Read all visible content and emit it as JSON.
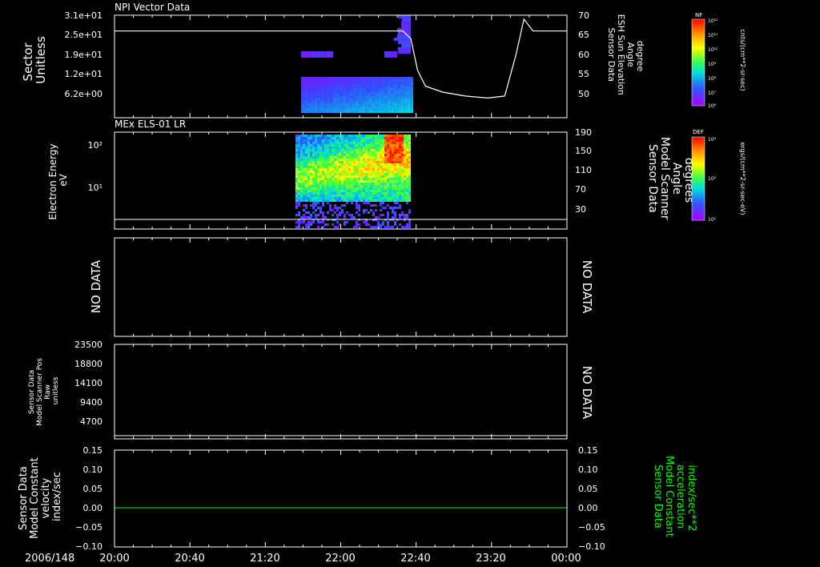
{
  "date_label": "2006/148",
  "x_ticks": [
    "20:00",
    "20:40",
    "21:20",
    "22:00",
    "22:40",
    "23:20",
    "00:00"
  ],
  "colors": {
    "frame": "#ffffff",
    "accent_green": "#00ff00",
    "background": "#000000"
  },
  "chart_data": [
    {
      "type": "heatmap",
      "title": "NPI Vector Data",
      "ylabel_lines": [
        "Sector",
        "Unitless"
      ],
      "y_ticks": [
        "3.1e+01",
        "2.5e+01",
        "1.9e+01",
        "1.2e+01",
        "6.2e+00"
      ],
      "y2_label_lines": [
        "Sensor Data",
        "ESH Sun Elevation",
        "Angle",
        "degree"
      ],
      "y2_ticks": [
        "70",
        "65",
        "60",
        "55",
        "50"
      ],
      "y2_range": [
        44,
        70
      ],
      "x_range_hours": [
        20,
        24
      ],
      "data_interval_hours": [
        21.65,
        22.62
      ],
      "colorbar": {
        "label": "NF",
        "units": "cnts/(cm**2-sr-sec)",
        "ticks": [
          "10¹²",
          "10¹¹",
          "10¹⁰",
          "10⁹",
          "10⁸",
          "10⁷",
          "10⁶"
        ]
      },
      "line_series": {
        "name": "ESH Sun Elevation Angle",
        "x_hours": [
          20.0,
          22.3,
          22.55,
          22.62,
          22.68,
          22.75,
          22.9,
          23.1,
          23.3,
          23.45,
          23.55,
          23.62,
          23.7,
          24.0
        ],
        "y_deg": [
          66,
          66,
          66,
          64,
          56,
          52,
          50.5,
          49.5,
          49,
          49.5,
          60,
          69,
          66,
          66
        ]
      }
    },
    {
      "type": "heatmap",
      "title": "MEx ELS-01 LR",
      "ylabel_lines": [
        "Electron Energy",
        "eV"
      ],
      "y_ticks": [
        "10²",
        "10¹"
      ],
      "y2_label_lines": [
        "Sensor Data",
        "Model Scanner",
        "Angle",
        "degrees"
      ],
      "y2_ticks": [
        "190",
        "150",
        "110",
        "70",
        "30"
      ],
      "y2_range": [
        0,
        190
      ],
      "x_range_hours": [
        20,
        24
      ],
      "data_interval_hours": [
        21.6,
        22.6
      ],
      "colorbar": {
        "label": "DEF",
        "units": "ergs/(cm**2-sr-sec-eV)",
        "ticks": [
          "10⁴",
          "10²",
          "10¹"
        ]
      },
      "line_series": {
        "name": "Model Scanner Angle",
        "x_hours": [
          20,
          24
        ],
        "y_deg": [
          12,
          12
        ]
      }
    },
    {
      "type": "line",
      "ylabel_lines": [
        "NO DATA"
      ],
      "y2_label_lines": [
        "NO DATA"
      ]
    },
    {
      "type": "line",
      "ylabel_lines": [
        "Sensor Data",
        "Model Scanner Pos",
        "Raw",
        "unitless"
      ],
      "y_ticks": [
        "23500",
        "18800",
        "14100",
        "9400",
        "4700"
      ],
      "ylim": [
        0,
        23500
      ],
      "y2_label_lines": [
        "NO DATA"
      ],
      "series": [
        {
          "x_hours": [
            20,
            24
          ],
          "values": [
            0,
            0
          ]
        }
      ]
    },
    {
      "type": "line",
      "ylabel_lines": [
        "Sensor Data",
        "Model Constant",
        "velocity",
        "index/sec"
      ],
      "y_ticks": [
        "0.15",
        "0.10",
        "0.05",
        "0.00",
        "−0.05",
        "−0.10"
      ],
      "y2_label_lines": [
        "Sensor Data",
        "Model Constant",
        "acceleration",
        "index/sec**2"
      ],
      "y2_ticks": [
        "0.15",
        "0.10",
        "0.05",
        "0.00",
        "−0.05",
        "−0.10"
      ],
      "ylim": [
        -0.1,
        0.15
      ],
      "series": [
        {
          "x_hours": [
            20,
            24
          ],
          "values": [
            0,
            0
          ],
          "color": "#00ff00"
        }
      ]
    }
  ]
}
